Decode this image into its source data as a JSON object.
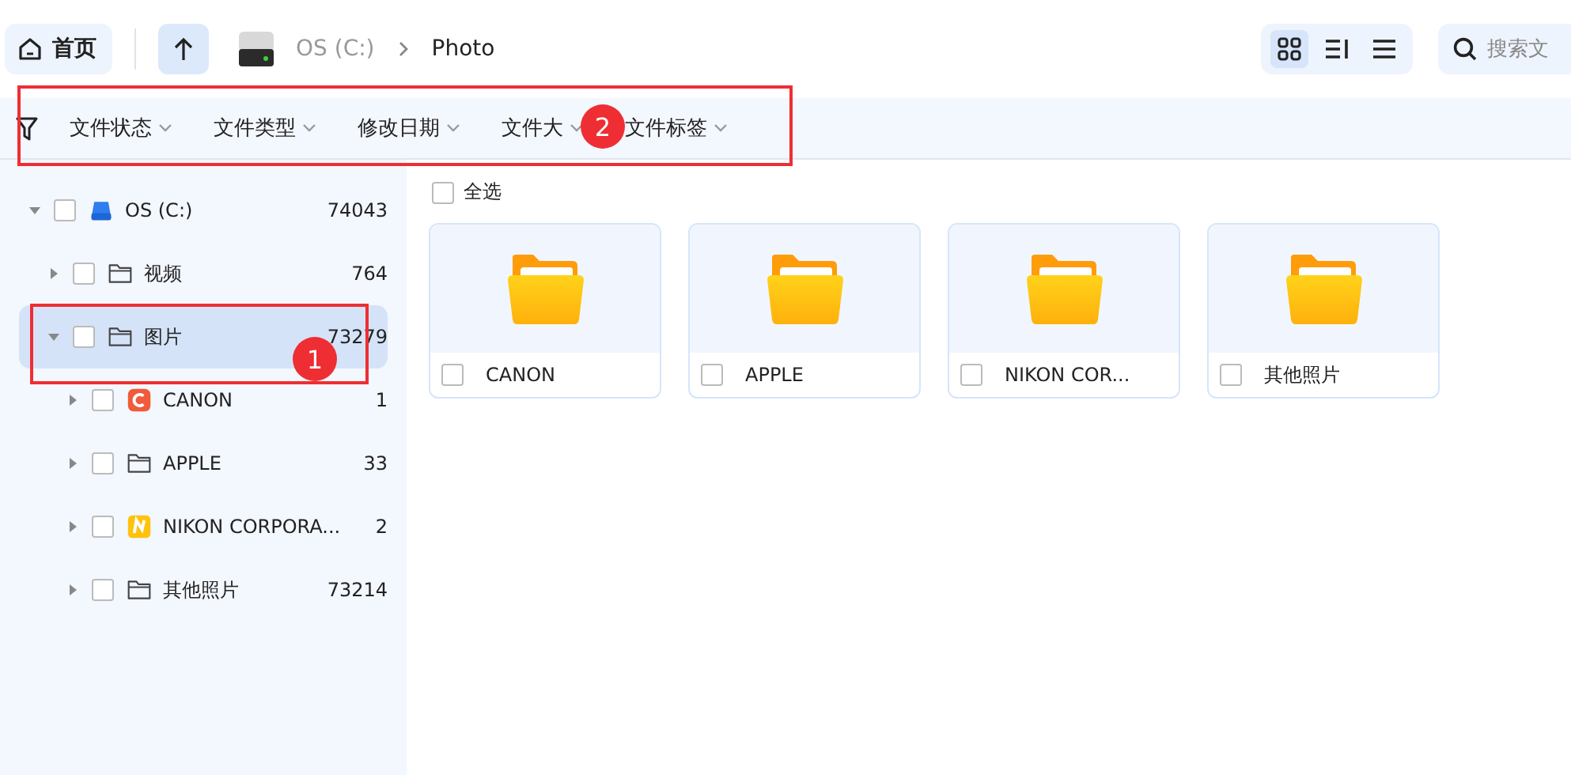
{
  "toolbar": {
    "home": "首页",
    "path": [
      {
        "label": "OS (C:)"
      },
      {
        "label": "Photo"
      }
    ],
    "views": [
      {
        "kind": "grid",
        "selected": true
      },
      {
        "kind": "detail",
        "selected": false
      },
      {
        "kind": "list",
        "selected": false
      }
    ],
    "search": {
      "placeholder": "搜索文"
    }
  },
  "filters": [
    {
      "label": "文件状态"
    },
    {
      "label": "文件类型"
    },
    {
      "label": "修改日期"
    },
    {
      "label": "文件大"
    },
    {
      "label": "文件标签"
    }
  ],
  "tree": [
    {
      "label": "OS (C:)",
      "count": "74043",
      "kind": "drive",
      "expanded": true,
      "checked": false,
      "selected": false,
      "children": [
        {
          "label": "视频",
          "count": "764",
          "kind": "folder",
          "expanded": false,
          "checked": false,
          "selected": false
        },
        {
          "label": "图片",
          "count": "73279",
          "kind": "folder",
          "expanded": true,
          "checked": false,
          "selected": true,
          "children": [
            {
              "label": "CANON",
              "count": "1",
              "kind": "redapp",
              "expanded": false,
              "checked": false,
              "selected": false
            },
            {
              "label": "APPLE",
              "count": "33",
              "kind": "folder",
              "expanded": false,
              "checked": false,
              "selected": false
            },
            {
              "label": "NIKON CORPORA...",
              "count": "2",
              "kind": "yellowapp",
              "expanded": false,
              "checked": false,
              "selected": false
            },
            {
              "label": "其他照片",
              "count": "73214",
              "kind": "folder",
              "expanded": false,
              "checked": false,
              "selected": false
            }
          ]
        }
      ]
    }
  ],
  "select_all": {
    "label": "全选",
    "checked": false
  },
  "cards": [
    {
      "name": "CANON",
      "checked": false
    },
    {
      "name": "APPLE",
      "checked": false
    },
    {
      "name": "NIKON COR...",
      "checked": false
    },
    {
      "name": "其他照片",
      "checked": false
    }
  ],
  "annotations": [
    {
      "number": "1"
    },
    {
      "number": "2"
    }
  ]
}
